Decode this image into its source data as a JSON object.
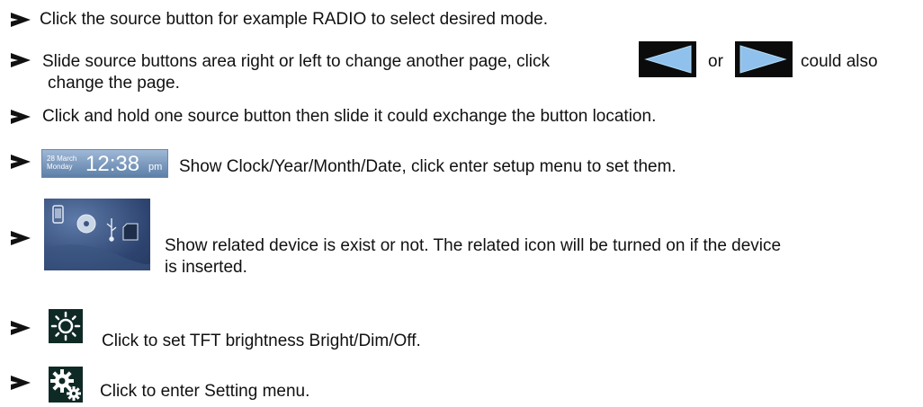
{
  "items": [
    {
      "text": "Click the source button for example RADIO to select desired mode."
    },
    {
      "text_a": "Slide source buttons area right or left  to change another page,  click",
      "text_or": "or",
      "text_b": "could also",
      "text_line2": "change the page.",
      "left_arrow_icon": "left-arrow-icon",
      "right_arrow_icon": "right-arrow-icon"
    },
    {
      "text": "Click and hold one source button  then slide it could exchange the button location."
    },
    {
      "text": "Show Clock/Year/Month/Date, click enter setup menu to set them.",
      "clock": {
        "date_line1": "28 March",
        "date_line2": "Monday",
        "time": "12:38",
        "ampm": "pm"
      }
    },
    {
      "text_line1": "Show related device is exist or not. The related icon will be  turned on if the device",
      "text_line2": "is inserted.",
      "icons": [
        "phone-icon",
        "disc-icon",
        "usb-icon",
        "sd-card-icon"
      ]
    },
    {
      "text": "Click to set TFT brightness Bright/Dim/Off.",
      "icon": "brightness-icon"
    },
    {
      "text": "Click to enter Setting menu.",
      "icon": "settings-gears-icon"
    }
  ],
  "colors": {
    "arrow_button_bg": "#0b0b0b",
    "arrow_fill": "#8fc1ec",
    "clock_bg": "#7f9dc3",
    "icon_tile_bg": "#0f2a25"
  }
}
